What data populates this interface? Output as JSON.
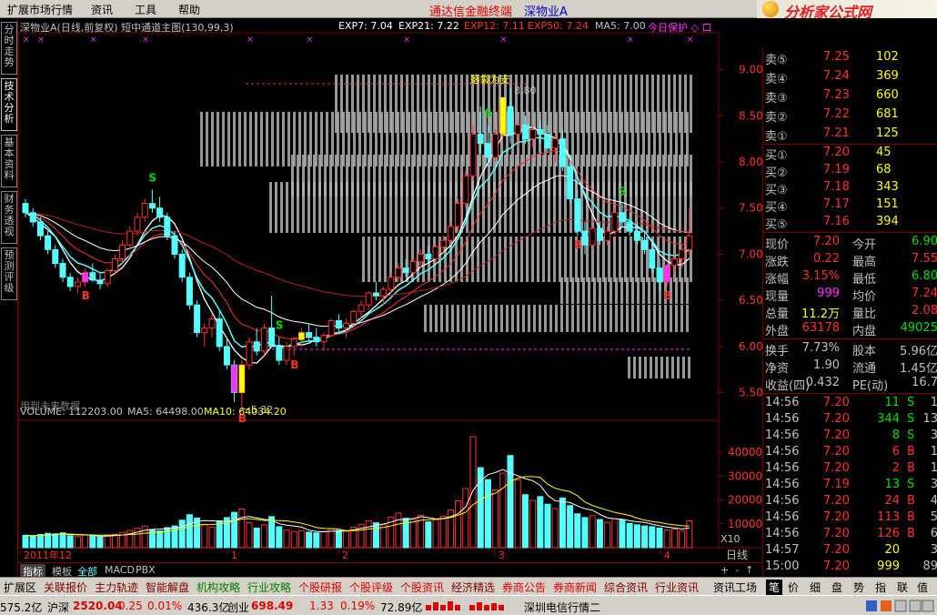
{
  "menu": [
    "扩展市场行情",
    "资讯",
    "工具",
    "帮助"
  ],
  "app_title": "通达信金融终端",
  "stock_title": "深物业A",
  "logo_text": "分析家公式网",
  "logo_url": "www.88gs.com",
  "left_tabs": [
    "分时走势",
    "技术分析",
    "基本资料",
    "财务透视",
    "预测评级"
  ],
  "header": {
    "name": "深物业A(日线,前复权) 短中通道主图(130,99,3)",
    "exp7": "EXP7: 7.04",
    "exp21": "EXP21: 7.22",
    "exp12": "EXP12: 7.11",
    "exp50": "EXP50: 7.24",
    "ma5": "MA5: 7.00",
    "today": "今日保护 ◇ 口"
  },
  "chart_data": {
    "type": "candlestick",
    "price_axis_ticks": [
      "9.00",
      "8.50",
      "8.00",
      "7.50",
      "7.00",
      "6.50",
      "6.00",
      "5.50"
    ],
    "price_range": [
      5.2,
      9.4
    ],
    "high_label": "8.80",
    "low_label": "5.32",
    "annotation_top": "落袋为安",
    "future_note": "用到未来数据",
    "signals_s": [
      "S",
      "S",
      "S",
      "S"
    ],
    "signals_b": [
      "B",
      "B",
      "B",
      "B",
      "B"
    ],
    "volume_header": {
      "vol": "VOLUME: 112203.00",
      "ma5": "MA5: 64498.00",
      "ma10": "MA10: 64034.20"
    },
    "volume_axis_ticks": [
      "40000",
      "30000",
      "20000",
      "10000"
    ],
    "volume_multiplier": "X10",
    "volume_range": [
      0,
      48000
    ],
    "date_labels": [
      "2011年12",
      "1",
      "2",
      "3",
      "4"
    ],
    "period_label": "日线",
    "candles": [
      [
        7.55,
        7.6,
        7.4,
        7.45
      ],
      [
        7.45,
        7.5,
        7.3,
        7.35
      ],
      [
        7.35,
        7.4,
        7.15,
        7.2
      ],
      [
        7.2,
        7.25,
        7.0,
        7.05
      ],
      [
        7.05,
        7.1,
        6.85,
        6.9
      ],
      [
        6.9,
        6.95,
        6.7,
        6.75
      ],
      [
        6.75,
        6.8,
        6.6,
        6.65
      ],
      [
        6.65,
        6.75,
        6.58,
        6.7
      ],
      [
        6.7,
        6.85,
        6.65,
        6.8
      ],
      [
        6.8,
        6.9,
        6.7,
        6.72
      ],
      [
        6.72,
        6.8,
        6.62,
        6.68
      ],
      [
        6.68,
        6.85,
        6.65,
        6.82
      ],
      [
        6.82,
        7.0,
        6.78,
        6.95
      ],
      [
        6.95,
        7.15,
        6.9,
        7.1
      ],
      [
        7.1,
        7.3,
        7.05,
        7.25
      ],
      [
        7.25,
        7.45,
        7.2,
        7.4
      ],
      [
        7.4,
        7.6,
        7.35,
        7.55
      ],
      [
        7.55,
        7.7,
        7.45,
        7.5
      ],
      [
        7.5,
        7.62,
        7.35,
        7.4
      ],
      [
        7.4,
        7.45,
        7.15,
        7.2
      ],
      [
        7.2,
        7.25,
        6.95,
        7.0
      ],
      [
        7.0,
        7.05,
        6.7,
        6.75
      ],
      [
        6.75,
        6.8,
        6.4,
        6.45
      ],
      [
        6.45,
        6.5,
        6.1,
        6.15
      ],
      [
        6.15,
        6.25,
        6.0,
        6.2
      ],
      [
        6.2,
        6.35,
        6.1,
        6.3
      ],
      [
        6.3,
        6.4,
        5.95,
        6.0
      ],
      [
        6.0,
        6.1,
        5.75,
        5.8
      ],
      [
        5.8,
        5.85,
        5.4,
        5.5
      ],
      [
        5.5,
        5.85,
        5.32,
        5.8
      ],
      [
        5.8,
        6.1,
        5.75,
        6.05
      ],
      [
        6.05,
        6.2,
        5.9,
        5.95
      ],
      [
        5.95,
        6.25,
        5.9,
        6.2
      ],
      [
        6.2,
        6.55,
        6.15,
        6.0
      ],
      [
        6.0,
        6.1,
        5.8,
        5.85
      ],
      [
        5.85,
        6.05,
        5.8,
        6.0
      ],
      [
        6.0,
        6.1,
        5.9,
        6.08
      ],
      [
        6.08,
        6.2,
        6.0,
        6.15
      ],
      [
        6.15,
        6.25,
        6.05,
        6.1
      ],
      [
        6.1,
        6.2,
        6.0,
        6.05
      ],
      [
        6.05,
        6.15,
        5.95,
        6.12
      ],
      [
        6.12,
        6.3,
        6.1,
        6.28
      ],
      [
        6.28,
        6.35,
        6.15,
        6.2
      ],
      [
        6.2,
        6.3,
        6.1,
        6.25
      ],
      [
        6.25,
        6.4,
        6.2,
        6.38
      ],
      [
        6.38,
        6.5,
        6.3,
        6.45
      ],
      [
        6.45,
        6.6,
        6.4,
        6.58
      ],
      [
        6.58,
        6.7,
        6.5,
        6.55
      ],
      [
        6.55,
        6.65,
        6.45,
        6.62
      ],
      [
        6.62,
        6.8,
        6.58,
        6.75
      ],
      [
        6.75,
        6.9,
        6.7,
        6.85
      ],
      [
        6.85,
        6.95,
        6.75,
        6.8
      ],
      [
        6.8,
        6.95,
        6.75,
        6.92
      ],
      [
        6.92,
        7.05,
        6.85,
        7.0
      ],
      [
        7.0,
        7.1,
        6.9,
        6.95
      ],
      [
        6.95,
        7.1,
        6.9,
        7.08
      ],
      [
        7.08,
        7.2,
        7.0,
        7.15
      ],
      [
        7.15,
        7.35,
        7.1,
        7.3
      ],
      [
        7.3,
        7.6,
        7.25,
        7.55
      ],
      [
        7.55,
        7.9,
        7.5,
        7.85
      ],
      [
        7.85,
        8.4,
        7.8,
        8.3
      ],
      [
        8.3,
        8.6,
        8.1,
        8.2
      ],
      [
        8.2,
        8.4,
        7.95,
        8.05
      ],
      [
        8.05,
        8.35,
        8.0,
        8.3
      ],
      [
        8.3,
        8.7,
        8.25,
        8.6
      ],
      [
        8.6,
        8.8,
        8.2,
        8.3
      ],
      [
        8.3,
        8.45,
        8.15,
        8.4
      ],
      [
        8.4,
        8.5,
        8.2,
        8.25
      ],
      [
        8.25,
        8.4,
        8.15,
        8.35
      ],
      [
        8.35,
        8.45,
        8.2,
        8.3
      ],
      [
        8.3,
        8.4,
        8.1,
        8.15
      ],
      [
        8.15,
        8.3,
        8.0,
        8.25
      ],
      [
        8.25,
        8.35,
        7.9,
        7.95
      ],
      [
        7.95,
        8.05,
        7.55,
        7.6
      ],
      [
        7.6,
        7.7,
        7.2,
        7.25
      ],
      [
        7.25,
        7.35,
        7.0,
        7.1
      ],
      [
        7.1,
        7.3,
        7.05,
        7.28
      ],
      [
        7.28,
        7.35,
        7.1,
        7.15
      ],
      [
        7.15,
        7.3,
        7.1,
        7.25
      ],
      [
        7.25,
        7.5,
        7.2,
        7.45
      ],
      [
        7.45,
        7.55,
        7.3,
        7.35
      ],
      [
        7.35,
        7.45,
        7.2,
        7.25
      ],
      [
        7.25,
        7.35,
        7.1,
        7.15
      ],
      [
        7.15,
        7.25,
        7.0,
        7.05
      ],
      [
        7.05,
        7.15,
        6.8,
        6.85
      ],
      [
        6.85,
        6.95,
        6.6,
        6.7
      ],
      [
        6.7,
        6.9,
        6.65,
        6.88
      ],
      [
        6.88,
        7.0,
        6.8,
        6.95
      ],
      [
        6.95,
        7.1,
        6.85,
        7.05
      ],
      [
        7.05,
        7.5,
        7.0,
        7.2
      ]
    ],
    "volumes": [
      5200,
      4800,
      5500,
      6000,
      5800,
      6200,
      5000,
      4600,
      5300,
      4900,
      4500,
      5100,
      5600,
      6400,
      7200,
      8100,
      9000,
      7600,
      7000,
      8400,
      9100,
      11500,
      13800,
      12400,
      9800,
      8600,
      11200,
      12600,
      14800,
      16200,
      10500,
      8200,
      9600,
      13000,
      8800,
      7400,
      6800,
      7100,
      6500,
      6200,
      6800,
      7900,
      7200,
      6900,
      8600,
      9800,
      11200,
      10400,
      9600,
      12800,
      14500,
      12300,
      11800,
      13600,
      10800,
      11700,
      13200,
      15800,
      19600,
      24800,
      46500,
      33500,
      28500,
      24200,
      31200,
      38600,
      28400,
      22200,
      19800,
      21400,
      18200,
      16400,
      20800,
      17600,
      14200,
      12600,
      13400,
      11800,
      10600,
      12200,
      11600,
      10200,
      9600,
      9100,
      8800,
      8200,
      7400,
      7800,
      6900,
      11220
    ]
  },
  "quote": {
    "asks": [
      {
        "label": "卖⑤",
        "price": "7.25",
        "vol": "102"
      },
      {
        "label": "卖④",
        "price": "7.24",
        "vol": "369"
      },
      {
        "label": "卖③",
        "price": "7.23",
        "vol": "660"
      },
      {
        "label": "卖②",
        "price": "7.22",
        "vol": "681"
      },
      {
        "label": "卖①",
        "price": "7.21",
        "vol": "125"
      }
    ],
    "bids": [
      {
        "label": "买①",
        "price": "7.20",
        "vol": "45"
      },
      {
        "label": "买②",
        "price": "7.19",
        "vol": "68"
      },
      {
        "label": "买③",
        "price": "7.18",
        "vol": "343"
      },
      {
        "label": "买④",
        "price": "7.17",
        "vol": "151"
      },
      {
        "label": "买⑤",
        "price": "7.16",
        "vol": "394"
      }
    ],
    "stats": [
      {
        "k1": "现价",
        "v1": "7.20",
        "c1": "#ff3030",
        "k2": "今开",
        "v2": "6.90",
        "c2": "#00e000"
      },
      {
        "k1": "涨跌",
        "v1": "0.22",
        "c1": "#ff3030",
        "k2": "最高",
        "v2": "7.55",
        "c2": "#ff3030"
      },
      {
        "k1": "涨幅",
        "v1": "3.15%",
        "c1": "#ff3030",
        "k2": "最低",
        "v2": "6.80",
        "c2": "#00e000"
      },
      {
        "k1": "现量",
        "v1": "999",
        "c1": "#ff30ff",
        "k2": "均价",
        "v2": "7.24",
        "c2": "#ff3030"
      },
      {
        "k1": "总量",
        "v1": "11.2万",
        "c1": "#ffff00",
        "k2": "量比",
        "v2": "2.08",
        "c2": "#ff3030"
      },
      {
        "k1": "外盘",
        "v1": "63178",
        "c1": "#ff3030",
        "k2": "内盘",
        "v2": "49025",
        "c2": "#00e000"
      }
    ],
    "stats2": [
      {
        "k1": "换手",
        "v1": "7.73%",
        "k2": "股本",
        "v2": "5.96亿"
      },
      {
        "k1": "净资",
        "v1": "1.90",
        "k2": "流通",
        "v2": "1.45亿"
      },
      {
        "k1": "收益(四)",
        "v1": "0.432",
        "k2": "PE(动)",
        "v2": "16.7"
      }
    ],
    "ticks": [
      {
        "time": "14:56",
        "price": "7.20",
        "vol": "11",
        "bs": "S",
        "n": "1"
      },
      {
        "time": "14:56",
        "price": "7.20",
        "vol": "344",
        "bs": "S",
        "n": "13"
      },
      {
        "time": "14:56",
        "price": "7.20",
        "vol": "8",
        "bs": "S",
        "n": "3"
      },
      {
        "time": "14:56",
        "price": "7.20",
        "vol": "6",
        "bs": "B",
        "n": "1"
      },
      {
        "time": "14:56",
        "price": "7.20",
        "vol": "2",
        "bs": "B",
        "n": "1"
      },
      {
        "time": "14:56",
        "price": "7.19",
        "vol": "13",
        "bs": "S",
        "n": "3"
      },
      {
        "time": "14:56",
        "price": "7.20",
        "vol": "24",
        "bs": "B",
        "n": "4"
      },
      {
        "time": "14:56",
        "price": "7.20",
        "vol": "113",
        "bs": "B",
        "n": "5"
      },
      {
        "time": "14:56",
        "price": "7.20",
        "vol": "126",
        "bs": "B",
        "n": "6"
      },
      {
        "time": "14:57",
        "price": "7.20",
        "vol": "20",
        "bs": "",
        "n": "3"
      },
      {
        "time": "15:00",
        "price": "7.20",
        "vol": "999",
        "bs": "",
        "n": "89"
      }
    ]
  },
  "indicator_tabs": [
    "指标",
    "模板",
    "全部",
    "MACD",
    "PBX"
  ],
  "bottom_tabs": [
    "扩展区",
    "关联报价",
    "主力轨迹",
    "智能解盘",
    "机构攻略",
    "行业攻略",
    "个股研报",
    "个股评级",
    "个股资讯",
    "经济精选",
    "券商公告",
    "券商新闻",
    "综合资讯",
    "行业资讯",
    "资讯工场"
  ],
  "right_tabs": [
    "笔",
    "价",
    "细",
    "盘",
    "势",
    "指",
    "联",
    "值"
  ],
  "status": {
    "s0": "575.2亿",
    "s1": "沪深",
    "s2": "2520.04",
    "s3": "0.25",
    "s4": "0.01%",
    "s5": "436.3亿",
    "s6": "创业",
    "s7": "698.49",
    "s8": "1.33",
    "s9": "0.19%",
    "s10": "72.89亿",
    "s11": "深圳电信行情二"
  },
  "colors": {
    "up": "#ff3030",
    "down": "#54ffff",
    "axis": "#800000",
    "yellow": "#ffff00"
  }
}
